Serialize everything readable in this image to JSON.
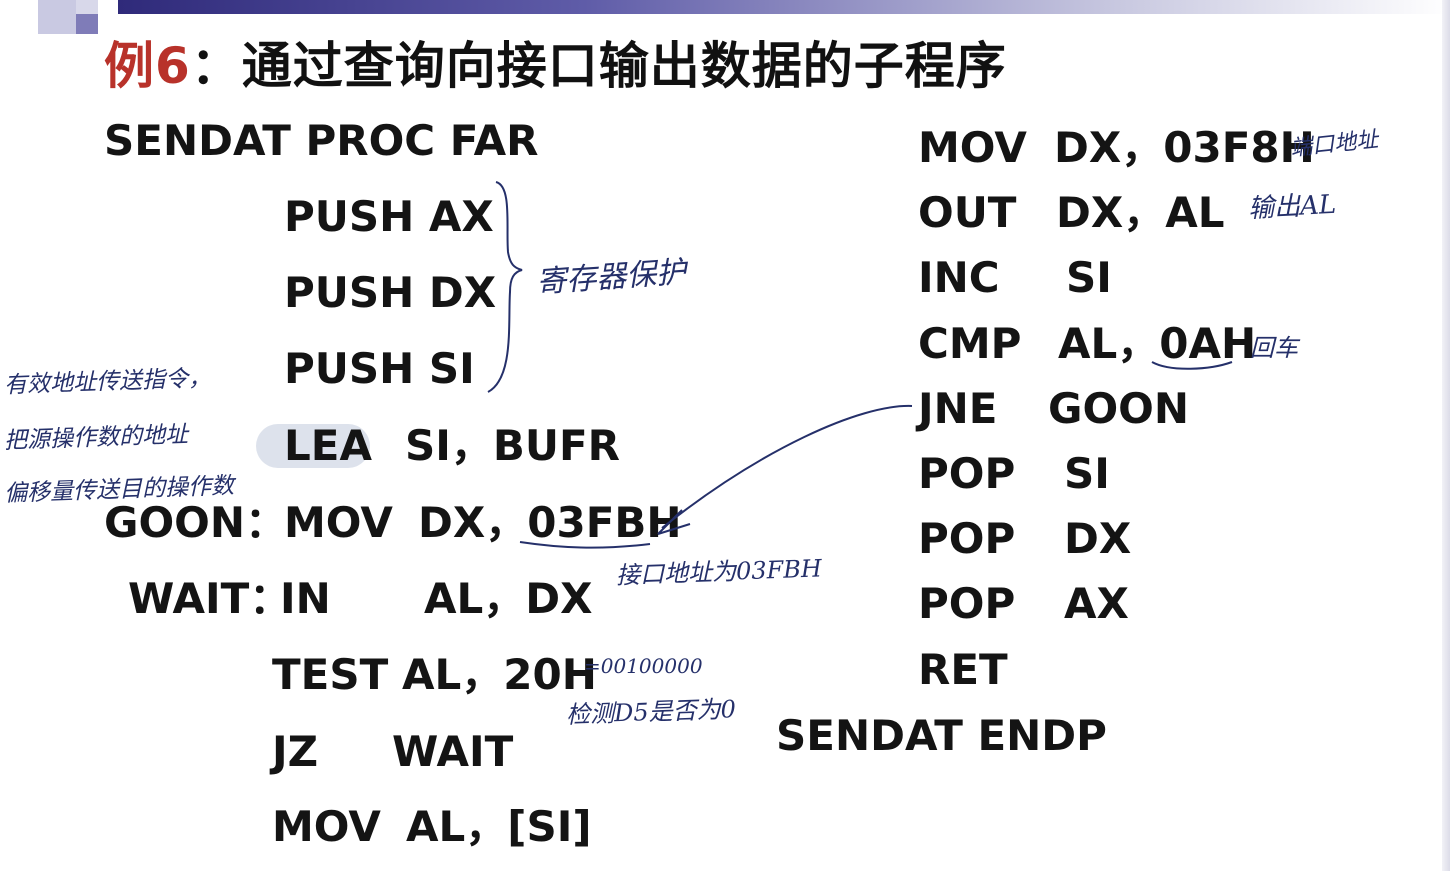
{
  "title": {
    "prefix": "例6",
    "text": "：通过查询向接口输出数据的子程序"
  },
  "left_code": {
    "l1": "SENDAT   PROC  FAR",
    "l2": "PUSH  AX",
    "l3": "PUSH  DX",
    "l4": "PUSH  SI",
    "l5_op": "LEA",
    "l5_args": "SI，BUFR",
    "l6_label": "GOON：",
    "l6_op": "MOV",
    "l6_args": "DX，03FBH",
    "l7_label": "WAIT：",
    "l7_op": "IN",
    "l7_args": "AL，DX",
    "l8_op": "TEST",
    "l8_args": "AL，20H",
    "l9_op": "JZ",
    "l9_args": "WAIT",
    "l10_op": "MOV",
    "l10_args": "AL，[SI]"
  },
  "right_code": {
    "r1_op": "MOV",
    "r1_args": "DX，03F8H",
    "r2_op": "OUT",
    "r2_args": "DX，AL",
    "r3_op": "INC",
    "r3_args": "SI",
    "r4_op": "CMP",
    "r4_args": "AL，0AH",
    "r5_op": "JNE",
    "r5_args": "GOON",
    "r6_op": "POP",
    "r6_args": "SI",
    "r7_op": "POP",
    "r7_args": "DX",
    "r8_op": "POP",
    "r8_args": "AX",
    "r9_op": "RET",
    "end": "SENDAT   ENDP"
  },
  "annotations": {
    "register_protect": "寄存器保护",
    "lea_note_1": "有效地址传送指令，",
    "lea_note_2": "把源操作数的地址",
    "lea_note_3": "偏移量传送目的操作数",
    "port_addr_note": "接口地址为03FBH",
    "test_binary": "=00100000",
    "test_note": "检测D5是否为0",
    "port_addr_right": "端口地址",
    "output_al": "输出AL",
    "newline": "回车"
  },
  "colors": {
    "title_prefix": "#b8322a",
    "ink": "#25306a",
    "highlight": "#dde2ec"
  }
}
